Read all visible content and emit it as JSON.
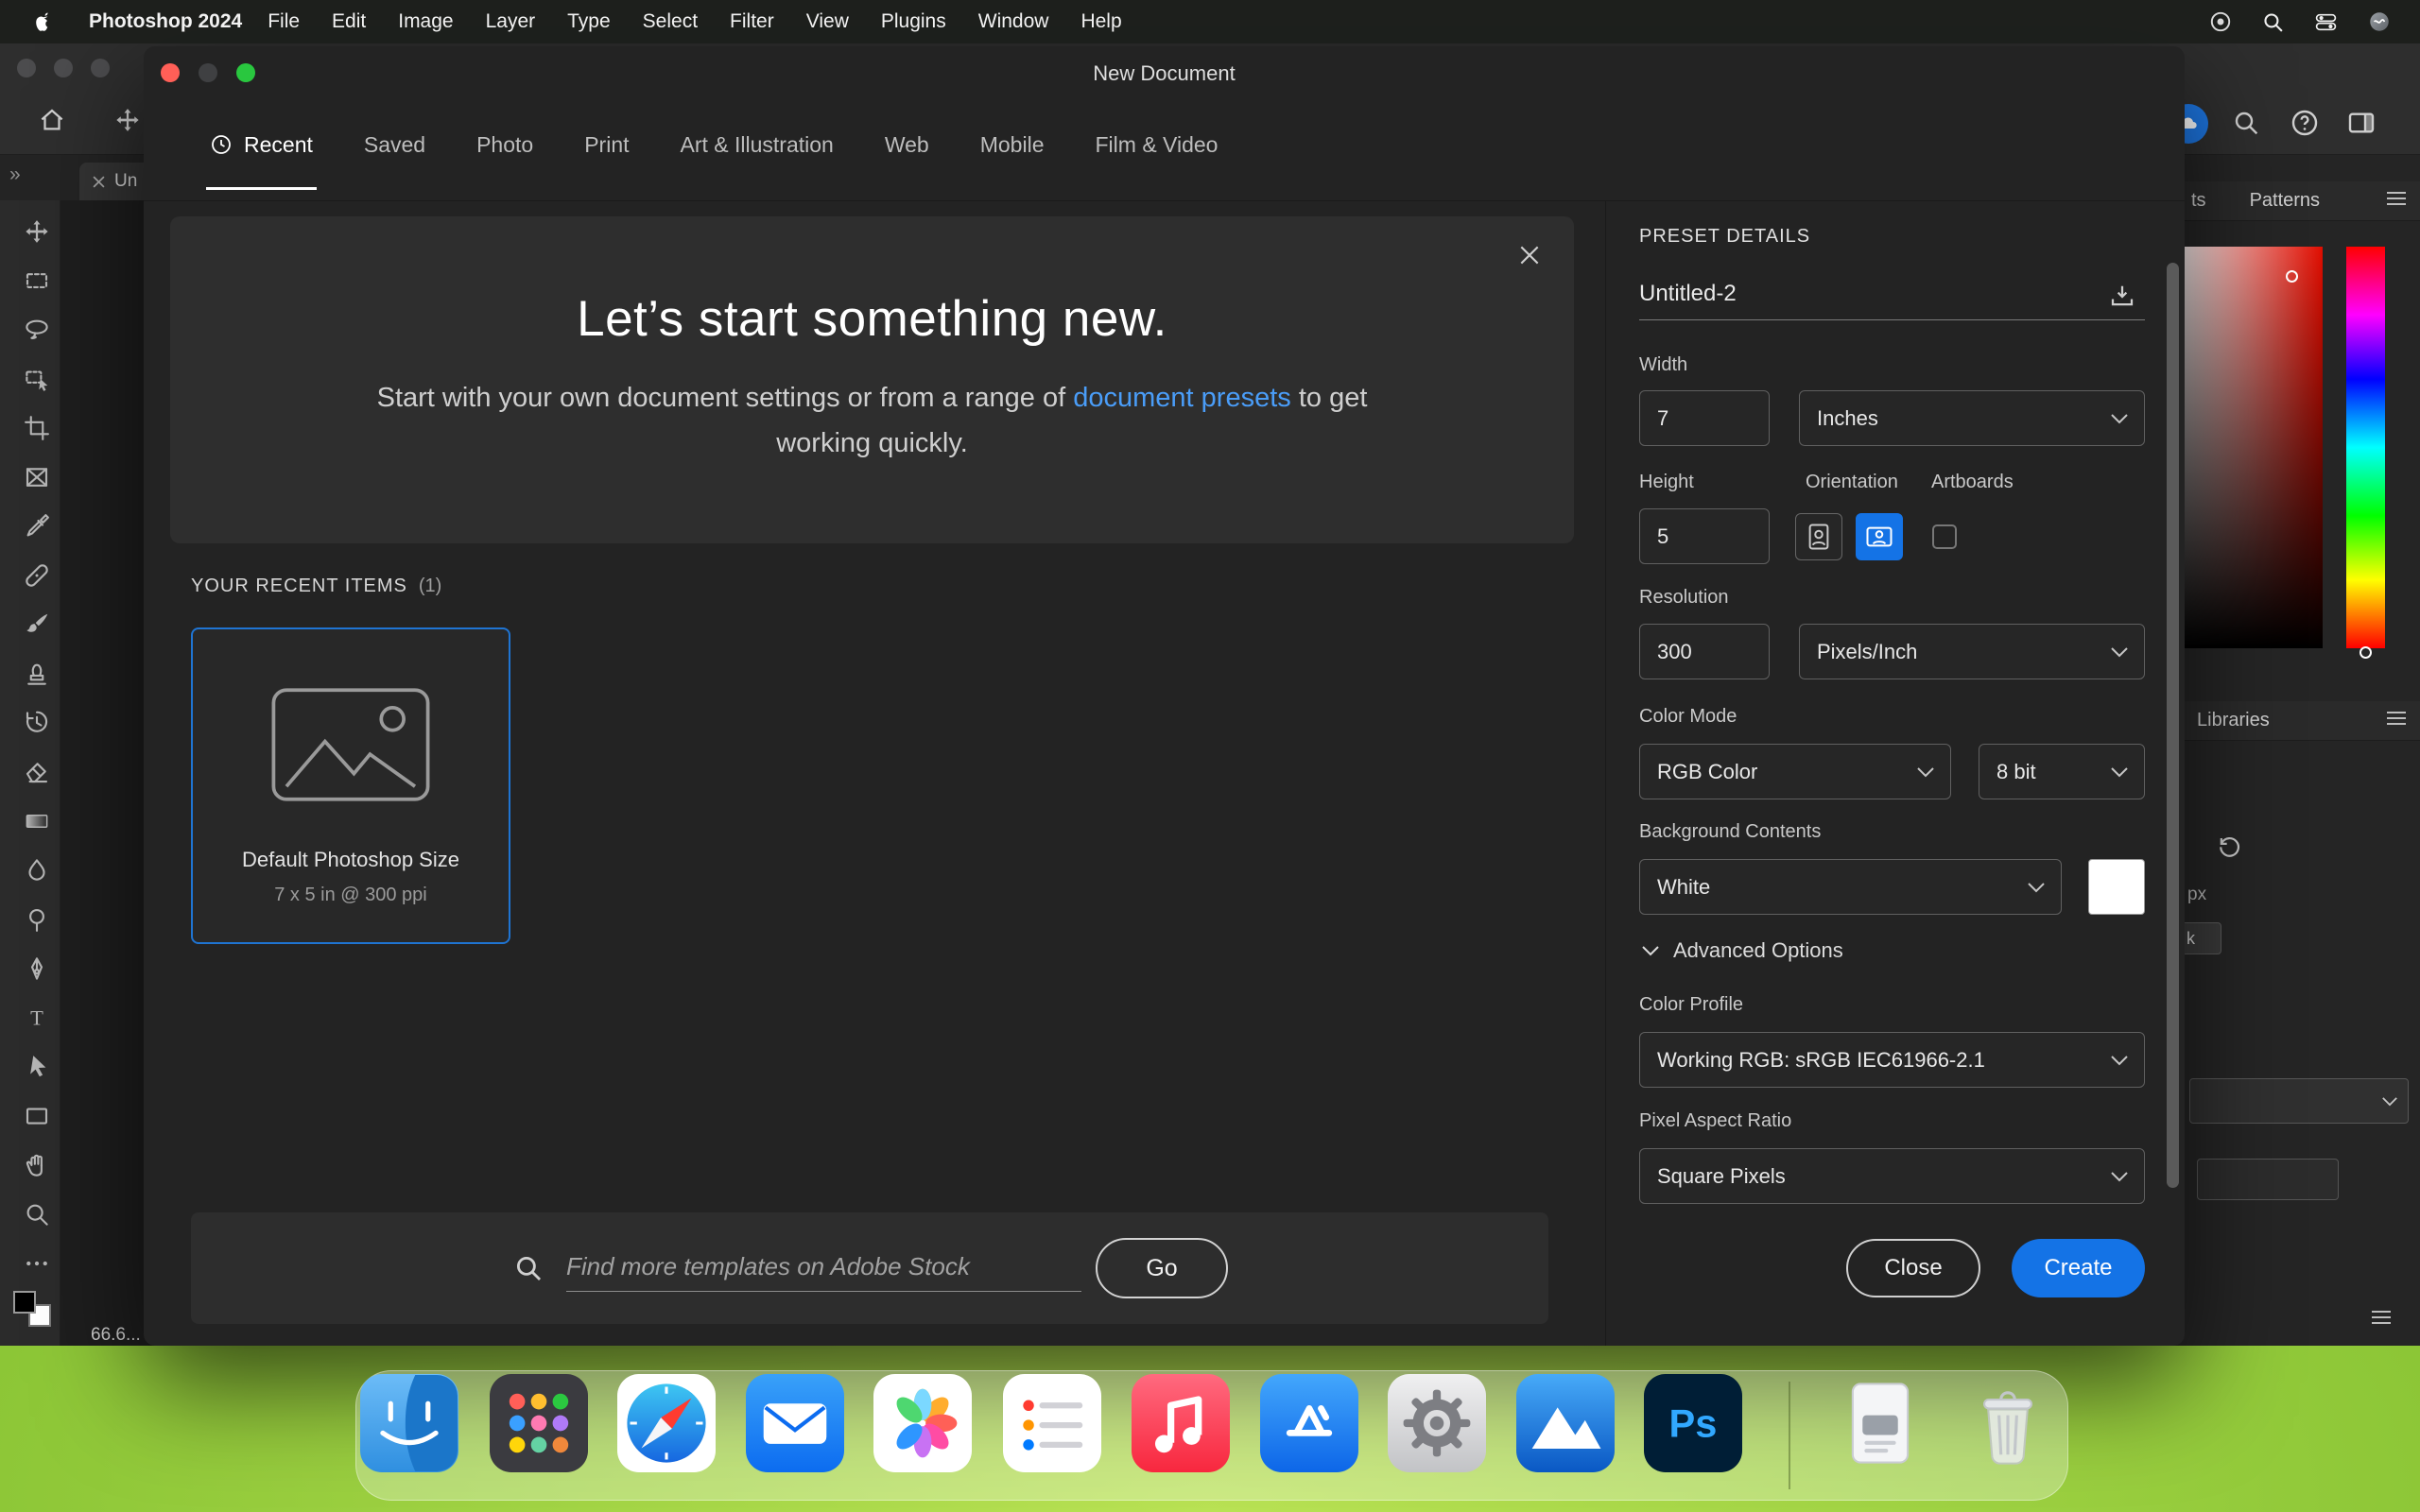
{
  "menu_bar": {
    "app_name": "Photoshop 2024",
    "items": [
      "File",
      "Edit",
      "Image",
      "Layer",
      "Type",
      "Select",
      "Filter",
      "View",
      "Plugins",
      "Window",
      "Help"
    ]
  },
  "window": {
    "doc_tab": "Un",
    "zoom_text": "66.6...",
    "panels": {
      "gradients_partial": "ts",
      "patterns_tab": "Patterns",
      "libraries_tab": "Libraries",
      "px_label": "px",
      "partial_text": "k"
    }
  },
  "dialog": {
    "title": "New Document",
    "tabs": [
      "Recent",
      "Saved",
      "Photo",
      "Print",
      "Art & Illustration",
      "Web",
      "Mobile",
      "Film & Video"
    ],
    "hero": {
      "title": "Let’s start something new.",
      "body_prefix": "Start with your own document settings or from a range of ",
      "link_text": "document presets",
      "body_suffix": " to get working quickly."
    },
    "recent": {
      "heading": "YOUR RECENT ITEMS",
      "count": "(1)",
      "card_title": "Default Photoshop Size",
      "card_subtitle": "7 x 5 in @ 300 ppi"
    },
    "search": {
      "placeholder": "Find more templates on Adobe Stock",
      "go": "Go"
    },
    "preset": {
      "heading": "PRESET DETAILS",
      "doc_name": "Untitled-2",
      "width_label": "Width",
      "width_value": "7",
      "unit": "Inches",
      "height_label": "Height",
      "height_value": "5",
      "orientation_label": "Orientation",
      "artboards_label": "Artboards",
      "resolution_label": "Resolution",
      "resolution_value": "300",
      "resolution_unit": "Pixels/Inch",
      "color_mode_label": "Color Mode",
      "color_mode_value": "RGB Color",
      "bit_depth_value": "8 bit",
      "background_label": "Background Contents",
      "background_value": "White",
      "advanced_label": "Advanced Options",
      "color_profile_label": "Color Profile",
      "color_profile_value": "Working RGB: sRGB IEC61966-2.1",
      "pixel_aspect_label": "Pixel Aspect Ratio",
      "pixel_aspect_value": "Square Pixels",
      "close": "Close",
      "create": "Create"
    }
  },
  "toolbar": {
    "tools": [
      "move-tool",
      "marquee-tool",
      "lasso-tool",
      "object-selection-tool",
      "crop-tool",
      "frame-tool",
      "eyedropper-tool",
      "healing-brush-tool",
      "brush-tool",
      "clone-stamp-tool",
      "history-brush-tool",
      "eraser-tool",
      "gradient-tool",
      "blur-tool",
      "dodge-tool",
      "pen-tool",
      "type-tool",
      "path-selection-tool",
      "rectangle-tool",
      "hand-tool",
      "zoom-tool",
      "more-tools"
    ]
  },
  "dock": {
    "apps": [
      "finder",
      "launchpad",
      "safari",
      "mail",
      "photos",
      "reminders",
      "music",
      "app-store",
      "system-settings",
      "blue-mountains-app",
      "photoshop",
      "document",
      "trash"
    ]
  },
  "colors": {
    "accent": "#1473e6",
    "link": "#4a9df8",
    "wallpaper_green": "#8cc636"
  }
}
